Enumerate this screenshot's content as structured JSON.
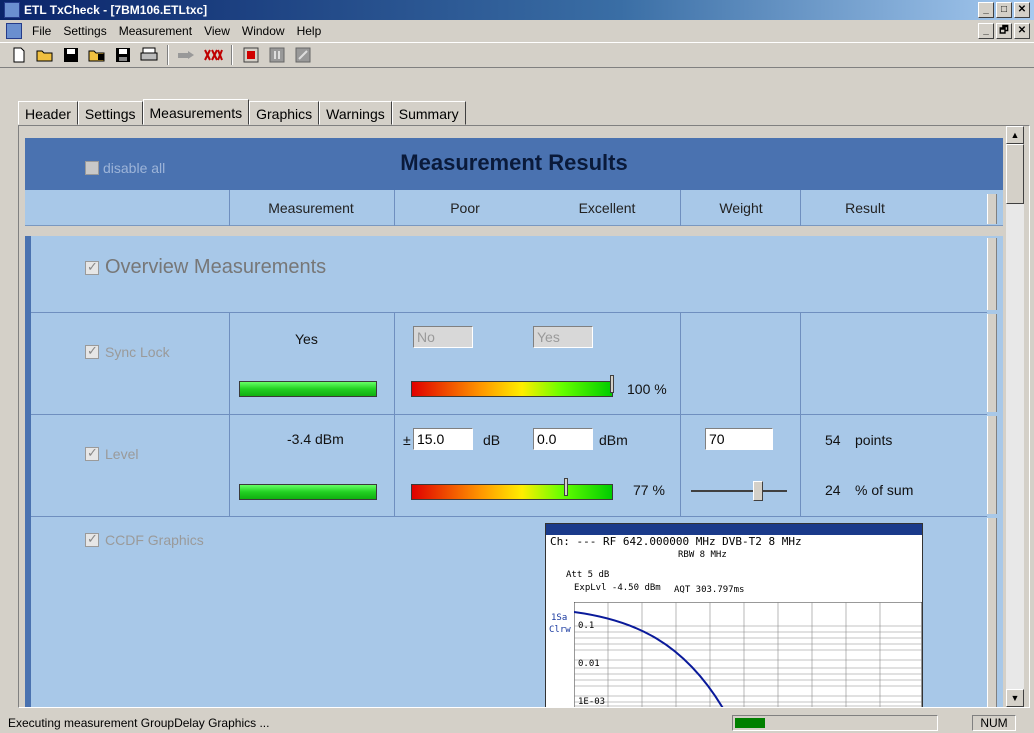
{
  "window": {
    "title": "ETL TxCheck - [7BM106.ETLtxc]",
    "buttons": [
      "_",
      "□",
      "✕"
    ],
    "mdi_buttons": [
      "_",
      "🗗",
      "✕"
    ]
  },
  "menu": [
    "File",
    "Settings",
    "Measurement",
    "View",
    "Window",
    "Help"
  ],
  "toolbar": {
    "icons": [
      "new-file-icon",
      "open-folder-icon",
      "save-icon",
      "save-folder-icon",
      "save-as-icon",
      "print-icon",
      "connect-icon",
      "network-icon",
      "stop-icon",
      "pause-icon",
      "step-icon"
    ]
  },
  "tabs": [
    {
      "label": "Header",
      "active": false
    },
    {
      "label": "Settings",
      "active": false
    },
    {
      "label": "Measurements",
      "active": true
    },
    {
      "label": "Graphics",
      "active": false
    },
    {
      "label": "Warnings",
      "active": false
    },
    {
      "label": "Summary",
      "active": false
    }
  ],
  "results": {
    "title": "Measurement Results",
    "disable_all": "disable all",
    "columns": {
      "measurement": "Measurement",
      "poor": "Poor",
      "excellent": "Excellent",
      "weight": "Weight",
      "result": "Result"
    },
    "overview": {
      "label": "Overview Measurements"
    },
    "sync_lock": {
      "label": "Sync Lock",
      "value": "Yes",
      "poor": "No",
      "excellent": "Yes",
      "percent": "100 %",
      "percent_value": 1.0
    },
    "level": {
      "label": "Level",
      "value": "-3.4 dBm",
      "plusminus": "±",
      "poor": "15.0",
      "poor_unit": "dB",
      "excellent": "0.0",
      "excellent_unit": "dBm",
      "weight": "70",
      "points": "54",
      "points_label": "points",
      "sum_percent": "24",
      "sum_label": "% of sum",
      "percent": "77 %",
      "percent_value": 0.77,
      "weight_slider_fraction": 0.7
    },
    "ccdf": {
      "label": "CCDF Graphics",
      "channel_line": "Ch: ---  RF 642.000000 MHz  DVB-T2  8 MHz",
      "rbw": "RBW 8 MHz",
      "att": "Att  5 dB",
      "explvl": "ExpLvl -4.50 dBm",
      "aqt": "AQT  303.797ms",
      "side_label_1": "1Sa",
      "side_label_2": "Clrw",
      "y_labels": [
        "0.1",
        "0.01",
        "1E-03"
      ]
    }
  },
  "status": {
    "text": "Executing measurement GroupDelay Graphics ...",
    "progress": 0.15,
    "num": "NUM"
  },
  "colors": {
    "header_band": "#4a72b0",
    "content_bg": "#a8c8e8",
    "title_bar": "#0a246a"
  }
}
